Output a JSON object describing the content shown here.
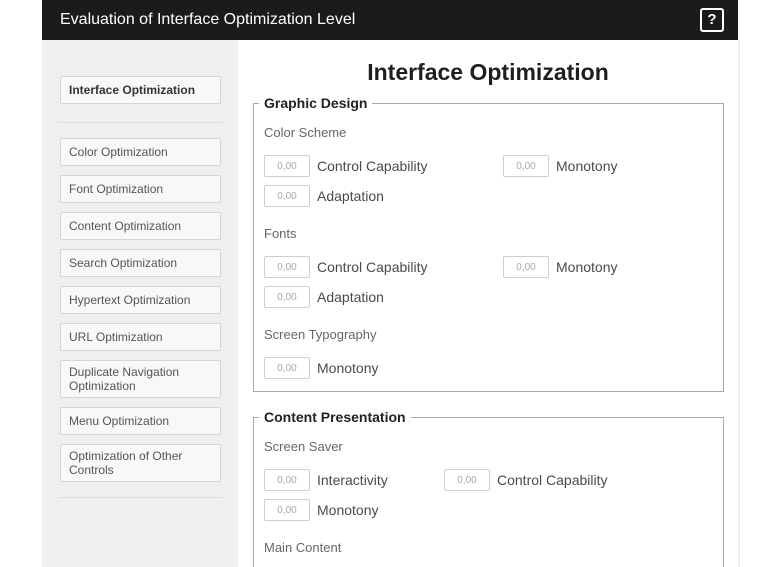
{
  "header": {
    "title": "Evaluation of Interface Optimization Level",
    "help_label": "?",
    "help_icon": "question-mark-icon"
  },
  "sidebar": {
    "items": [
      {
        "label": "Interface Optimization",
        "active": true
      },
      {
        "label": "Color Optimization",
        "active": false
      },
      {
        "label": "Font Optimization",
        "active": false
      },
      {
        "label": "Content Optimization",
        "active": false
      },
      {
        "label": "Search Optimization",
        "active": false
      },
      {
        "label": "Hypertext Optimization",
        "active": false
      },
      {
        "label": "URL Optimization",
        "active": false
      },
      {
        "label": "Duplicate Navigation Optimization",
        "active": false
      },
      {
        "label": "Menu Optimization",
        "active": false
      },
      {
        "label": "Optimization of Other Controls",
        "active": false
      }
    ]
  },
  "main": {
    "title": "Interface Optimization",
    "sections": [
      {
        "legend": "Graphic Design",
        "groups": [
          {
            "heading": "Color Scheme",
            "fields": [
              {
                "label": "Control Capability",
                "placeholder": "0,00"
              },
              {
                "label": "Monotony",
                "placeholder": "0,00"
              },
              {
                "label": "Adaptation",
                "placeholder": "0,00"
              }
            ]
          },
          {
            "heading": "Fonts",
            "fields": [
              {
                "label": "Control Capability",
                "placeholder": "0,00"
              },
              {
                "label": "Monotony",
                "placeholder": "0,00"
              },
              {
                "label": "Adaptation",
                "placeholder": "0,00"
              }
            ]
          },
          {
            "heading": "Screen Typography",
            "fields": [
              {
                "label": "Monotony",
                "placeholder": "0,00"
              }
            ]
          }
        ]
      },
      {
        "legend": "Content Presentation",
        "groups": [
          {
            "heading": "Screen Saver",
            "fields": [
              {
                "label": "Interactivity",
                "placeholder": "0,00"
              },
              {
                "label": "Control Capability",
                "placeholder": "0,00"
              },
              {
                "label": "Monotony",
                "placeholder": "0,00"
              }
            ]
          },
          {
            "heading": "Main Content",
            "fields": []
          }
        ]
      }
    ]
  },
  "theme": {
    "header_bg": "#1b1b1b",
    "shell_bg": "#efefef",
    "panel_bg": "#ffffff",
    "btn_bg": "#f8f8f8",
    "btn_border": "#d5d5d5",
    "fs_border": "#a9a9a9"
  }
}
